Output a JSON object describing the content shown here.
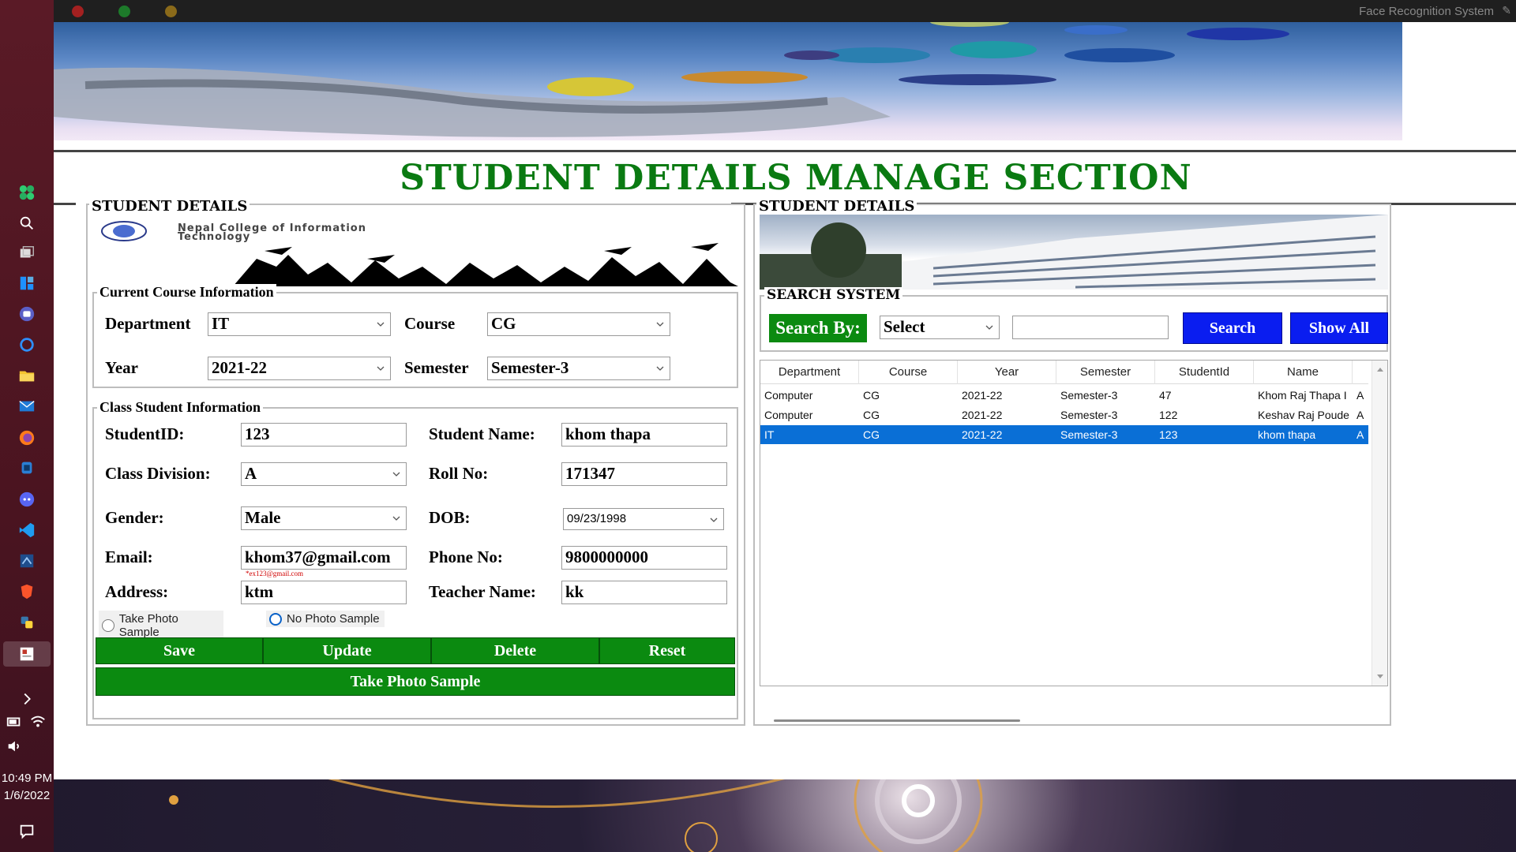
{
  "window": {
    "title": "Face Recognition System"
  },
  "taskbar": {
    "clock_time": "10:49 PM",
    "clock_date": "1/6/2022",
    "icons": [
      "start-icon",
      "search-icon",
      "task-view-icon",
      "widgets-icon",
      "teams-icon",
      "cortana-icon",
      "file-explorer-icon",
      "mail-icon",
      "firefox-icon",
      "app-icon",
      "discord-icon",
      "vscode-icon",
      "sql-icon",
      "brave-icon",
      "python-icon",
      "app-window-icon"
    ]
  },
  "page_title": "STUDENT DETAILS MANAGE SECTION",
  "left_panel": {
    "legend": "STUDENT DETAILS",
    "college_name_line1": "Nepal College of Information",
    "college_name_line2": "Technology",
    "course_group": {
      "legend": "Current Course Information",
      "department_label": "Department",
      "department_value": "IT",
      "course_label": "Course",
      "course_value": "CG",
      "year_label": "Year",
      "year_value": "2021-22",
      "semester_label": "Semester",
      "semester_value": "Semester-3"
    },
    "student_group": {
      "legend": "Class Student Information",
      "student_id_label": "StudentID:",
      "student_id_value": "123",
      "student_name_label": "Student Name:",
      "student_name_value": "khom thapa",
      "class_division_label": "Class Division:",
      "class_division_value": "A",
      "roll_no_label": "Roll No:",
      "roll_no_value": "171347",
      "gender_label": "Gender:",
      "gender_value": "Male",
      "dob_label": "DOB:",
      "dob_value": "09/23/1998",
      "email_label": "Email:",
      "email_value": "khom37@gmail.com",
      "email_hint": "*ex123@gmail.com",
      "phone_label": "Phone No:",
      "phone_value": "9800000000",
      "address_label": "Address:",
      "address_value": "ktm",
      "teacher_label": "Teacher Name:",
      "teacher_value": "kk",
      "radio_take_photo": "Take Photo Sample",
      "radio_no_photo": "No Photo Sample",
      "radio_selected": "No Photo Sample"
    },
    "buttons": {
      "save": "Save",
      "update": "Update",
      "delete": "Delete",
      "reset": "Reset",
      "take_photo": "Take Photo Sample"
    }
  },
  "right_panel": {
    "legend": "STUDENT DETAILS",
    "search_legend": "SEARCH SYSTEM",
    "search_by_label": "Search By:",
    "search_select_value": "Select",
    "search_input_value": "",
    "search_button": "Search",
    "show_all_button": "Show All",
    "table": {
      "columns": [
        "Department",
        "Course",
        "Year",
        "Semester",
        "StudentId",
        "Name"
      ],
      "rows": [
        {
          "department": "Computer",
          "course": "CG",
          "year": "2021-22",
          "semester": "Semester-3",
          "student_id": "47",
          "name": "Khom Raj Thapa I",
          "extra": "A"
        },
        {
          "department": "Computer",
          "course": "CG",
          "year": "2021-22",
          "semester": "Semester-3",
          "student_id": "122",
          "name": "Keshav Raj Poude",
          "extra": "A"
        },
        {
          "department": "IT",
          "course": "CG",
          "year": "2021-22",
          "semester": "Semester-3",
          "student_id": "123",
          "name": "khom thapa",
          "extra": "A"
        }
      ],
      "selected_row": 2
    }
  },
  "colors": {
    "title_green": "#0a7a12",
    "button_green": "#0b8a10",
    "button_blue": "#0a1df0",
    "selection_blue": "#0a6fd6",
    "taskbar": "#4a1420"
  }
}
